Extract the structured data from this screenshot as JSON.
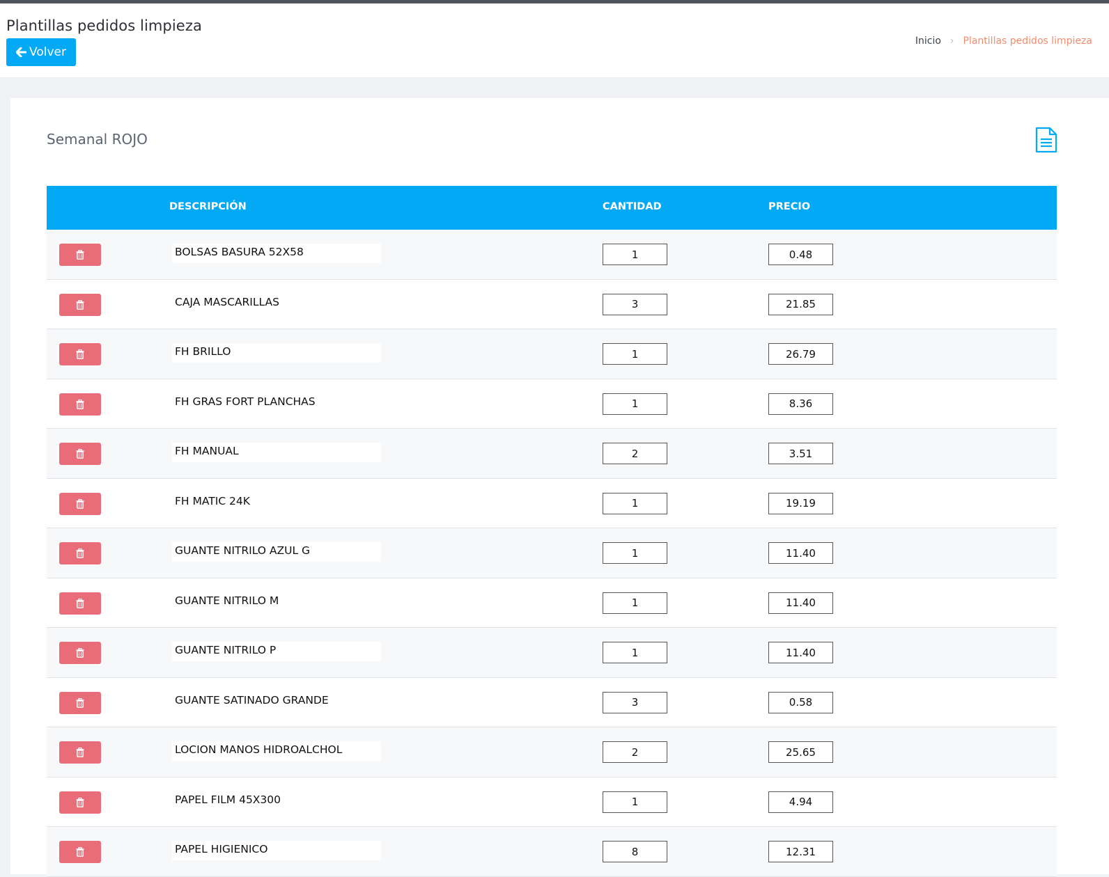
{
  "header": {
    "title": "Plantillas pedidos limpieza",
    "back_label": "Volver",
    "breadcrumb": {
      "home": "Inicio",
      "current": "Plantillas pedidos limpieza"
    }
  },
  "card": {
    "title": "Semanal ROJO",
    "doc_icon": "document-icon"
  },
  "table": {
    "columns": {
      "description": "DESCRIPCIÓN",
      "quantity": "CANTIDAD",
      "price": "PRECIO"
    },
    "rows": [
      {
        "description": "BOLSAS BASURA 52X58",
        "quantity": "1",
        "price": "0.48"
      },
      {
        "description": "CAJA MASCARILLAS",
        "quantity": "3",
        "price": "21.85"
      },
      {
        "description": "FH BRILLO",
        "quantity": "1",
        "price": "26.79"
      },
      {
        "description": "FH GRAS FORT PLANCHAS",
        "quantity": "1",
        "price": "8.36"
      },
      {
        "description": "FH MANUAL",
        "quantity": "2",
        "price": "3.51"
      },
      {
        "description": "FH MATIC 24K",
        "quantity": "1",
        "price": "19.19"
      },
      {
        "description": "GUANTE NITRILO AZUL G",
        "quantity": "1",
        "price": "11.40"
      },
      {
        "description": "GUANTE NITRILO M",
        "quantity": "1",
        "price": "11.40"
      },
      {
        "description": "GUANTE NITRILO P",
        "quantity": "1",
        "price": "11.40"
      },
      {
        "description": "GUANTE SATINADO GRANDE",
        "quantity": "3",
        "price": "0.58"
      },
      {
        "description": "LOCION MANOS HIDROALCHOL",
        "quantity": "2",
        "price": "25.65"
      },
      {
        "description": "PAPEL FILM 45X300",
        "quantity": "1",
        "price": "4.94"
      },
      {
        "description": "PAPEL HIGIENICO",
        "quantity": "8",
        "price": "12.31"
      }
    ]
  },
  "colors": {
    "accent": "#03a9f4",
    "delete": "#e96c79",
    "breadcrumb_active": "#f48b6b"
  }
}
